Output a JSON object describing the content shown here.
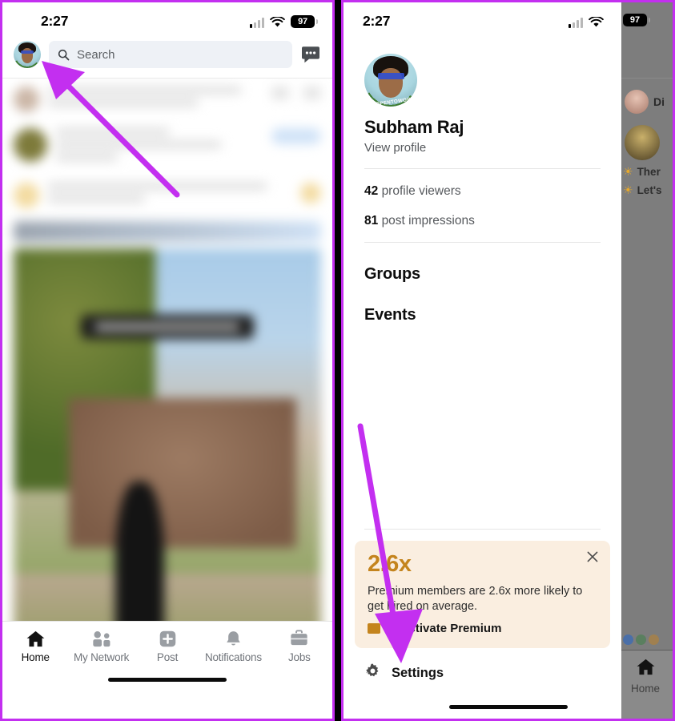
{
  "status_bar": {
    "time": "2:27",
    "battery": "97",
    "signal_icon": "cellular-signal-icon",
    "wifi_icon": "wifi-icon",
    "battery_icon": "battery-icon"
  },
  "left_screen": {
    "header": {
      "avatar_icon": "profile-avatar-icon",
      "search_icon": "search-icon",
      "search_placeholder": "Search",
      "messaging_icon": "messaging-icon"
    },
    "feed_note": "blurred LinkedIn feed content",
    "tabbar": {
      "items": [
        {
          "label": "Home",
          "icon": "home-icon",
          "active": true
        },
        {
          "label": "My Network",
          "icon": "my-network-icon",
          "active": false
        },
        {
          "label": "Post",
          "icon": "post-plus-icon",
          "active": false
        },
        {
          "label": "Notifications",
          "icon": "bell-icon",
          "active": false
        },
        {
          "label": "Jobs",
          "icon": "briefcase-icon",
          "active": false
        }
      ]
    }
  },
  "right_screen": {
    "drawer": {
      "avatar_icon": "profile-avatar-icon",
      "open_to_work_badge": "#OPENTOWORK",
      "name": "Subham Raj",
      "view_profile": "View profile",
      "stats": [
        {
          "value": "42",
          "label": "profile viewers"
        },
        {
          "value": "81",
          "label": "post impressions"
        }
      ],
      "menu": [
        {
          "label": "Groups"
        },
        {
          "label": "Events"
        }
      ],
      "premium": {
        "headline": "2.6x",
        "description": "Premium members are 2.6x more likely to get hired on average.",
        "cta_label": "Reactivate Premium",
        "close_icon": "close-icon",
        "badge_icon": "premium-badge-icon",
        "bg_color": "#faeee0",
        "accent_color": "#c4841d"
      },
      "settings": {
        "label": "Settings",
        "icon": "gear-icon"
      }
    },
    "dimmed_feed": {
      "battery": "97",
      "entries": [
        {
          "text": "Di"
        },
        {
          "text": "Ther"
        },
        {
          "text": "Let's"
        }
      ],
      "tab_label": "Home",
      "tab_icon": "home-icon"
    }
  },
  "annotations": {
    "arrow_color": "#c32ff0",
    "arrows": [
      {
        "name": "arrow-to-profile-avatar",
        "points_to": "left-screen-profile-avatar"
      },
      {
        "name": "arrow-to-settings",
        "points_to": "right-screen-settings"
      }
    ]
  }
}
